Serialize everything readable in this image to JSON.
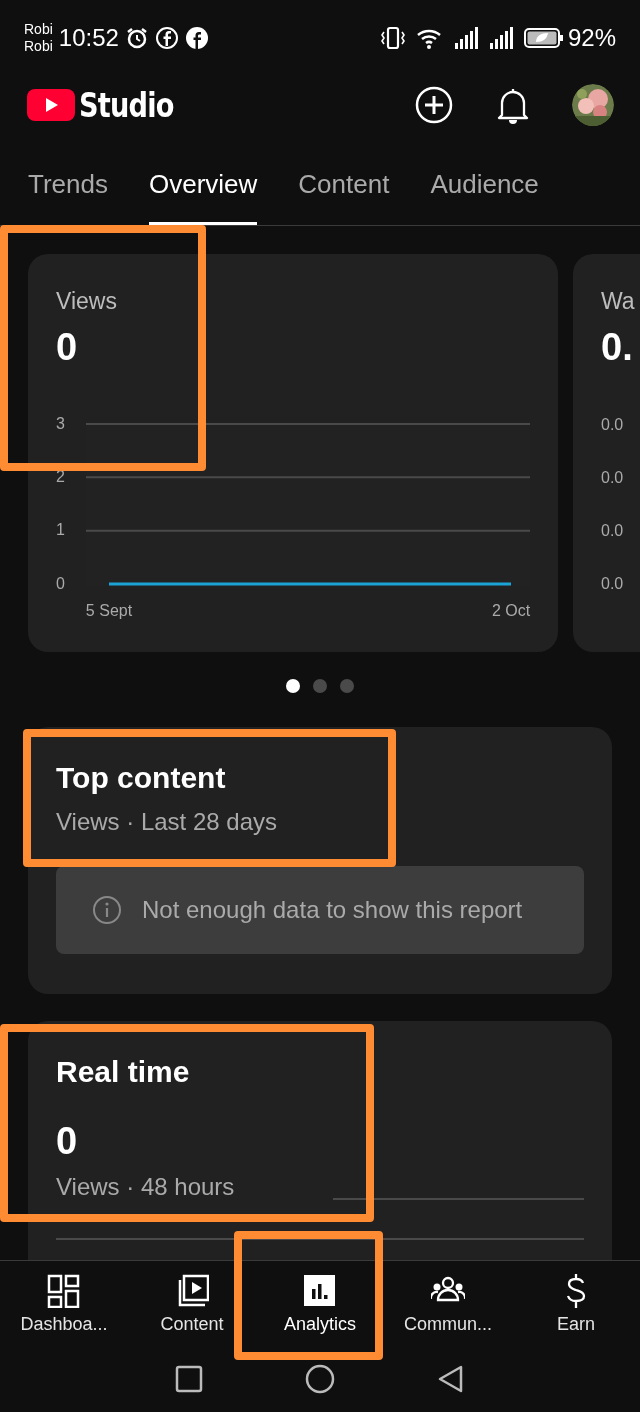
{
  "status_bar": {
    "carrier_top": "Robi",
    "carrier_bottom": "Robi",
    "time": "10:52",
    "battery": "92%"
  },
  "header": {
    "title": "Studio"
  },
  "tabs": [
    {
      "label": "Trends",
      "selected": false
    },
    {
      "label": "Overview",
      "selected": true
    },
    {
      "label": "Content",
      "selected": false
    },
    {
      "label": "Audience",
      "selected": false
    }
  ],
  "metric_cards": [
    {
      "label": "Views",
      "value": "0",
      "highlighted": true,
      "chart_data": {
        "type": "line",
        "categories": [
          "5 Sept",
          "2 Oct"
        ],
        "ylim": [
          0,
          3
        ],
        "ref_lines": [
          {
            "axis": "y",
            "value": 1
          },
          {
            "axis": "y",
            "value": 2
          },
          {
            "axis": "y",
            "value": 3
          }
        ],
        "yticks": [
          0,
          1,
          2,
          3
        ],
        "series": [
          {
            "color": "#1aa3d4",
            "values": [
              0,
              0
            ]
          }
        ]
      }
    },
    {
      "label": "Wa",
      "value": "0.",
      "tick_labels": [
        "0.0",
        "0.0",
        "0.0",
        "0.0"
      ]
    }
  ],
  "carousel_dots": [
    {
      "selected": true
    },
    {
      "selected": false
    },
    {
      "selected": false
    }
  ],
  "top_content": {
    "title": "Top content",
    "subtitle": "Views · Last 28 days",
    "message": "Not enough data to show this report",
    "highlighted": true
  },
  "real_time": {
    "title": "Real time",
    "value": "0",
    "subtitle": "Views · 48 hours",
    "highlighted": true
  },
  "bottom_nav": [
    {
      "label": "Dashboa...",
      "selected": false,
      "highlighted": false
    },
    {
      "label": "Content",
      "selected": false,
      "highlighted": false
    },
    {
      "label": "Analytics",
      "selected": true,
      "highlighted": true
    },
    {
      "label": "Commun...",
      "selected": false,
      "highlighted": false
    },
    {
      "label": "Earn",
      "selected": false,
      "highlighted": false
    }
  ]
}
